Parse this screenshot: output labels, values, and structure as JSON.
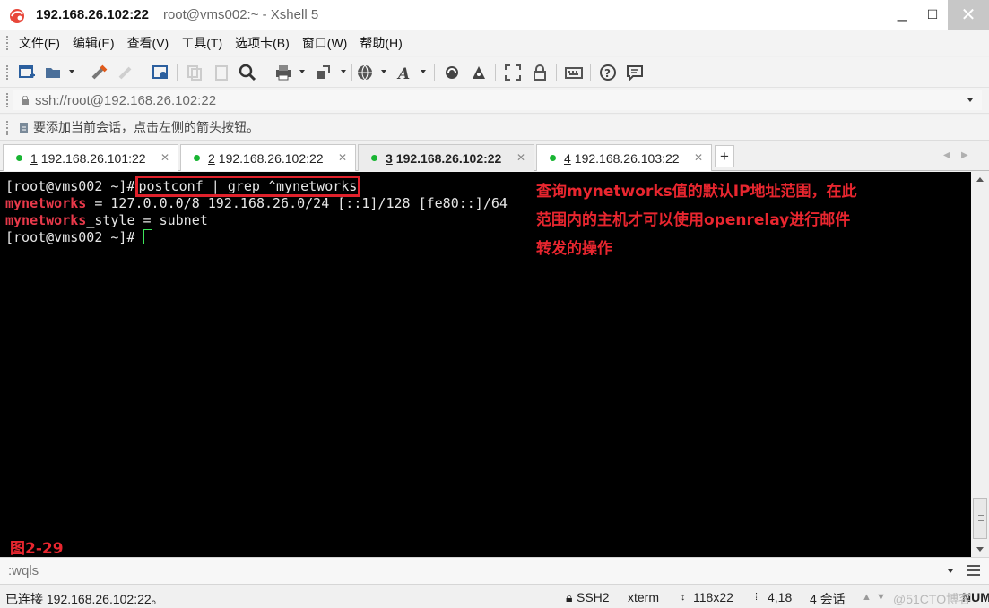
{
  "window": {
    "title_host": "192.168.26.102:22",
    "title_rest": "root@vms002:~ - Xshell 5"
  },
  "menu": [
    "文件(F)",
    "编辑(E)",
    "查看(V)",
    "工具(T)",
    "选项卡(B)",
    "窗口(W)",
    "帮助(H)"
  ],
  "address": {
    "value": "ssh://root@192.168.26.102:22"
  },
  "hint": {
    "text": "要添加当前会话，点击左侧的箭头按钮。"
  },
  "tabs": [
    {
      "num": "1",
      "label": "192.168.26.101:22",
      "active": false
    },
    {
      "num": "2",
      "label": "192.168.26.102:22",
      "active": false
    },
    {
      "num": "3",
      "label": "192.168.26.102:22",
      "active": true
    },
    {
      "num": "4",
      "label": "192.168.26.103:22",
      "active": false
    }
  ],
  "terminal": {
    "prompt": "[root@vms002 ~]#",
    "command": "postconf | grep ^mynetworks",
    "out1_key": "mynetworks",
    "out1_rest": " = 127.0.0.0/8 192.168.26.0/24 [::1]/128 [fe80::]/64",
    "out2_key": "mynetworks",
    "out2_rest": "_style = subnet"
  },
  "annotation": {
    "lines": [
      "查询mynetworks值的默认IP地址范围，在此",
      "范围内的主机才可以使用openrelay进行邮件",
      "转发的操作"
    ],
    "figure": "图2-29"
  },
  "compose": {
    "value": ":wqls"
  },
  "status": {
    "connected": "已连接 192.168.26.102:22。",
    "protocol": "SSH2",
    "term": "xterm",
    "size": "118x22",
    "cursor": "4,18",
    "sessions": "4 会话",
    "mode": "NUM",
    "watermark": "@51CTO博客"
  }
}
